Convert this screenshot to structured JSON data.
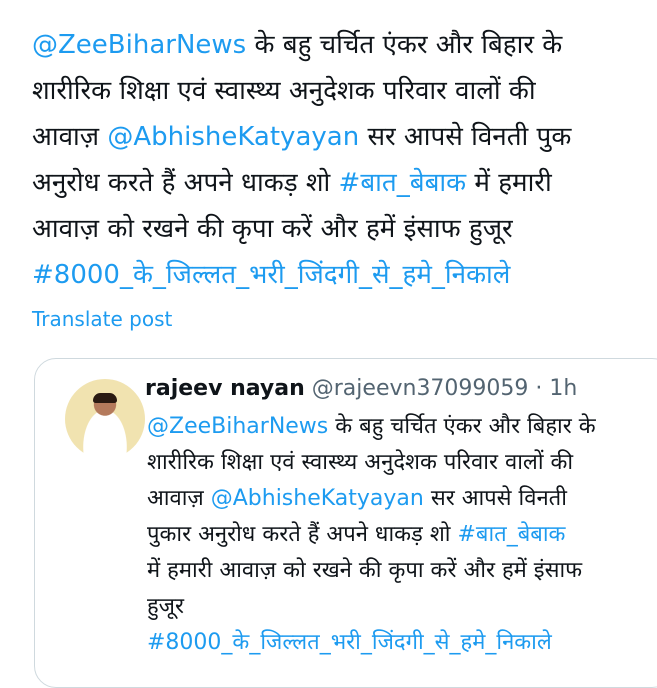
{
  "tweet": {
    "lines": [
      [
        {
          "t": "@ZeeBiharNews",
          "link": true
        },
        {
          "t": " के बहु चर्चित एंकर और बिहार के",
          "link": false
        }
      ],
      [
        {
          "t": "शारीरिक शिक्षा एवं स्वास्थ्य अनुदेशक परिवार वालों की",
          "link": false
        }
      ],
      [
        {
          "t": "आवाज़ ",
          "link": false
        },
        {
          "t": "@AbhisheKatyayan",
          "link": true
        },
        {
          "t": " सर आपसे विनती पुक",
          "link": false
        }
      ],
      [
        {
          "t": "अनुरोध करते हैं अपने धाकड़ शो ",
          "link": false
        },
        {
          "t": "#बात_बेबाक",
          "link": true
        },
        {
          "t": " में हमारी",
          "link": false
        }
      ],
      [
        {
          "t": "आवाज़ को रखने की कृपा करें और हमें इंसाफ हुजूर",
          "link": false
        }
      ],
      [
        {
          "t": "#8000_के_जिल्लत_भरी_जिंदगी_से_हमे_निकाले",
          "link": true
        }
      ]
    ],
    "translate_label": "Translate post"
  },
  "quote": {
    "display_name": "rajeev nayan",
    "handle": "@rajeevn37099059",
    "separator": " · ",
    "time": "1h",
    "lines": [
      [
        {
          "t": "@ZeeBiharNews",
          "link": true
        },
        {
          "t": " के बहु चर्चित एंकर और बिहार के",
          "link": false
        }
      ],
      [
        {
          "t": "शारीरिक शिक्षा एवं स्वास्थ्य अनुदेशक परिवार वालों की",
          "link": false
        }
      ],
      [
        {
          "t": "आवाज़ ",
          "link": false
        },
        {
          "t": "@AbhisheKatyayan",
          "link": true
        },
        {
          "t": " सर आपसे विनती",
          "link": false
        }
      ],
      [
        {
          "t": "पुकार अनुरोध करते हैं अपने धाकड़ शो ",
          "link": false
        },
        {
          "t": "#बात_बेबाक",
          "link": true
        }
      ],
      [
        {
          "t": "में हमारी आवाज़ को रखने की कृपा करें और हमें इंसाफ",
          "link": false
        }
      ],
      [
        {
          "t": "हुजूर",
          "link": false
        }
      ],
      [
        {
          "t": "#8000_के_जिल्लत_भरी_जिंदगी_से_हमे_निकाले",
          "link": true
        }
      ]
    ]
  },
  "colors": {
    "link": "#1d9bf0",
    "text": "#0f1419",
    "muted": "#536471",
    "border": "#cfd9de"
  }
}
